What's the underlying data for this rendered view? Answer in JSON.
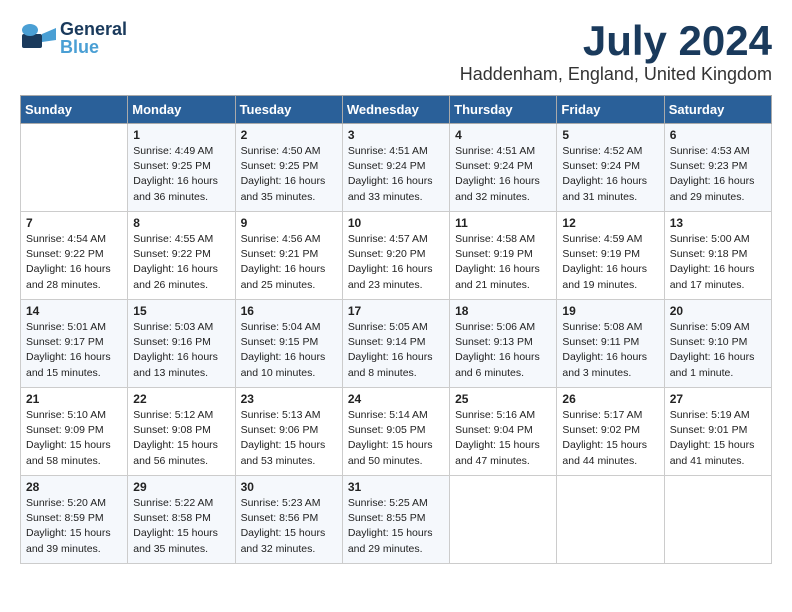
{
  "header": {
    "logo_line1": "General",
    "logo_line2": "Blue",
    "month_title": "July 2024",
    "location": "Haddenham, England, United Kingdom"
  },
  "days_of_week": [
    "Sunday",
    "Monday",
    "Tuesday",
    "Wednesday",
    "Thursday",
    "Friday",
    "Saturday"
  ],
  "weeks": [
    [
      {
        "num": "",
        "detail": ""
      },
      {
        "num": "1",
        "detail": "Sunrise: 4:49 AM\nSunset: 9:25 PM\nDaylight: 16 hours\nand 36 minutes."
      },
      {
        "num": "2",
        "detail": "Sunrise: 4:50 AM\nSunset: 9:25 PM\nDaylight: 16 hours\nand 35 minutes."
      },
      {
        "num": "3",
        "detail": "Sunrise: 4:51 AM\nSunset: 9:24 PM\nDaylight: 16 hours\nand 33 minutes."
      },
      {
        "num": "4",
        "detail": "Sunrise: 4:51 AM\nSunset: 9:24 PM\nDaylight: 16 hours\nand 32 minutes."
      },
      {
        "num": "5",
        "detail": "Sunrise: 4:52 AM\nSunset: 9:24 PM\nDaylight: 16 hours\nand 31 minutes."
      },
      {
        "num": "6",
        "detail": "Sunrise: 4:53 AM\nSunset: 9:23 PM\nDaylight: 16 hours\nand 29 minutes."
      }
    ],
    [
      {
        "num": "7",
        "detail": "Sunrise: 4:54 AM\nSunset: 9:22 PM\nDaylight: 16 hours\nand 28 minutes."
      },
      {
        "num": "8",
        "detail": "Sunrise: 4:55 AM\nSunset: 9:22 PM\nDaylight: 16 hours\nand 26 minutes."
      },
      {
        "num": "9",
        "detail": "Sunrise: 4:56 AM\nSunset: 9:21 PM\nDaylight: 16 hours\nand 25 minutes."
      },
      {
        "num": "10",
        "detail": "Sunrise: 4:57 AM\nSunset: 9:20 PM\nDaylight: 16 hours\nand 23 minutes."
      },
      {
        "num": "11",
        "detail": "Sunrise: 4:58 AM\nSunset: 9:19 PM\nDaylight: 16 hours\nand 21 minutes."
      },
      {
        "num": "12",
        "detail": "Sunrise: 4:59 AM\nSunset: 9:19 PM\nDaylight: 16 hours\nand 19 minutes."
      },
      {
        "num": "13",
        "detail": "Sunrise: 5:00 AM\nSunset: 9:18 PM\nDaylight: 16 hours\nand 17 minutes."
      }
    ],
    [
      {
        "num": "14",
        "detail": "Sunrise: 5:01 AM\nSunset: 9:17 PM\nDaylight: 16 hours\nand 15 minutes."
      },
      {
        "num": "15",
        "detail": "Sunrise: 5:03 AM\nSunset: 9:16 PM\nDaylight: 16 hours\nand 13 minutes."
      },
      {
        "num": "16",
        "detail": "Sunrise: 5:04 AM\nSunset: 9:15 PM\nDaylight: 16 hours\nand 10 minutes."
      },
      {
        "num": "17",
        "detail": "Sunrise: 5:05 AM\nSunset: 9:14 PM\nDaylight: 16 hours\nand 8 minutes."
      },
      {
        "num": "18",
        "detail": "Sunrise: 5:06 AM\nSunset: 9:13 PM\nDaylight: 16 hours\nand 6 minutes."
      },
      {
        "num": "19",
        "detail": "Sunrise: 5:08 AM\nSunset: 9:11 PM\nDaylight: 16 hours\nand 3 minutes."
      },
      {
        "num": "20",
        "detail": "Sunrise: 5:09 AM\nSunset: 9:10 PM\nDaylight: 16 hours\nand 1 minute."
      }
    ],
    [
      {
        "num": "21",
        "detail": "Sunrise: 5:10 AM\nSunset: 9:09 PM\nDaylight: 15 hours\nand 58 minutes."
      },
      {
        "num": "22",
        "detail": "Sunrise: 5:12 AM\nSunset: 9:08 PM\nDaylight: 15 hours\nand 56 minutes."
      },
      {
        "num": "23",
        "detail": "Sunrise: 5:13 AM\nSunset: 9:06 PM\nDaylight: 15 hours\nand 53 minutes."
      },
      {
        "num": "24",
        "detail": "Sunrise: 5:14 AM\nSunset: 9:05 PM\nDaylight: 15 hours\nand 50 minutes."
      },
      {
        "num": "25",
        "detail": "Sunrise: 5:16 AM\nSunset: 9:04 PM\nDaylight: 15 hours\nand 47 minutes."
      },
      {
        "num": "26",
        "detail": "Sunrise: 5:17 AM\nSunset: 9:02 PM\nDaylight: 15 hours\nand 44 minutes."
      },
      {
        "num": "27",
        "detail": "Sunrise: 5:19 AM\nSunset: 9:01 PM\nDaylight: 15 hours\nand 41 minutes."
      }
    ],
    [
      {
        "num": "28",
        "detail": "Sunrise: 5:20 AM\nSunset: 8:59 PM\nDaylight: 15 hours\nand 39 minutes."
      },
      {
        "num": "29",
        "detail": "Sunrise: 5:22 AM\nSunset: 8:58 PM\nDaylight: 15 hours\nand 35 minutes."
      },
      {
        "num": "30",
        "detail": "Sunrise: 5:23 AM\nSunset: 8:56 PM\nDaylight: 15 hours\nand 32 minutes."
      },
      {
        "num": "31",
        "detail": "Sunrise: 5:25 AM\nSunset: 8:55 PM\nDaylight: 15 hours\nand 29 minutes."
      },
      {
        "num": "",
        "detail": ""
      },
      {
        "num": "",
        "detail": ""
      },
      {
        "num": "",
        "detail": ""
      }
    ]
  ]
}
